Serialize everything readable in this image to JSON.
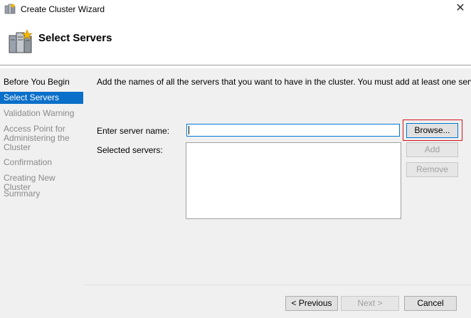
{
  "window": {
    "title": "Create Cluster Wizard",
    "close_glyph": "✕",
    "icon": "cluster-wizard-icon"
  },
  "header": {
    "title": "Select Servers",
    "icon": "servers-icon"
  },
  "sidebar": {
    "items": [
      {
        "label": "Before You Begin",
        "state": "done"
      },
      {
        "label": "Select Servers",
        "state": "active"
      },
      {
        "label": "Validation Warning",
        "state": "pending"
      },
      {
        "label": "Access Point for Administering the Cluster",
        "state": "pending"
      },
      {
        "label": "Confirmation",
        "state": "pending"
      },
      {
        "label": "Creating New Cluster",
        "state": "pending"
      },
      {
        "label": "Summary",
        "state": "pending"
      }
    ]
  },
  "main": {
    "intro": "Add the names of all the servers that you want to have in the cluster. You must add at least one server.",
    "server_name_label": "Enter server name:",
    "server_name_value": "",
    "selected_servers_label": "Selected servers:",
    "browse_label": "Browse...",
    "add_label": "Add",
    "remove_label": "Remove"
  },
  "footer": {
    "previous_label": "< Previous",
    "next_label": "Next >",
    "cancel_label": "Cancel"
  },
  "colors": {
    "accent": "#0a6fc9",
    "highlight": "#d4151b",
    "panel": "#f0f0f0"
  }
}
